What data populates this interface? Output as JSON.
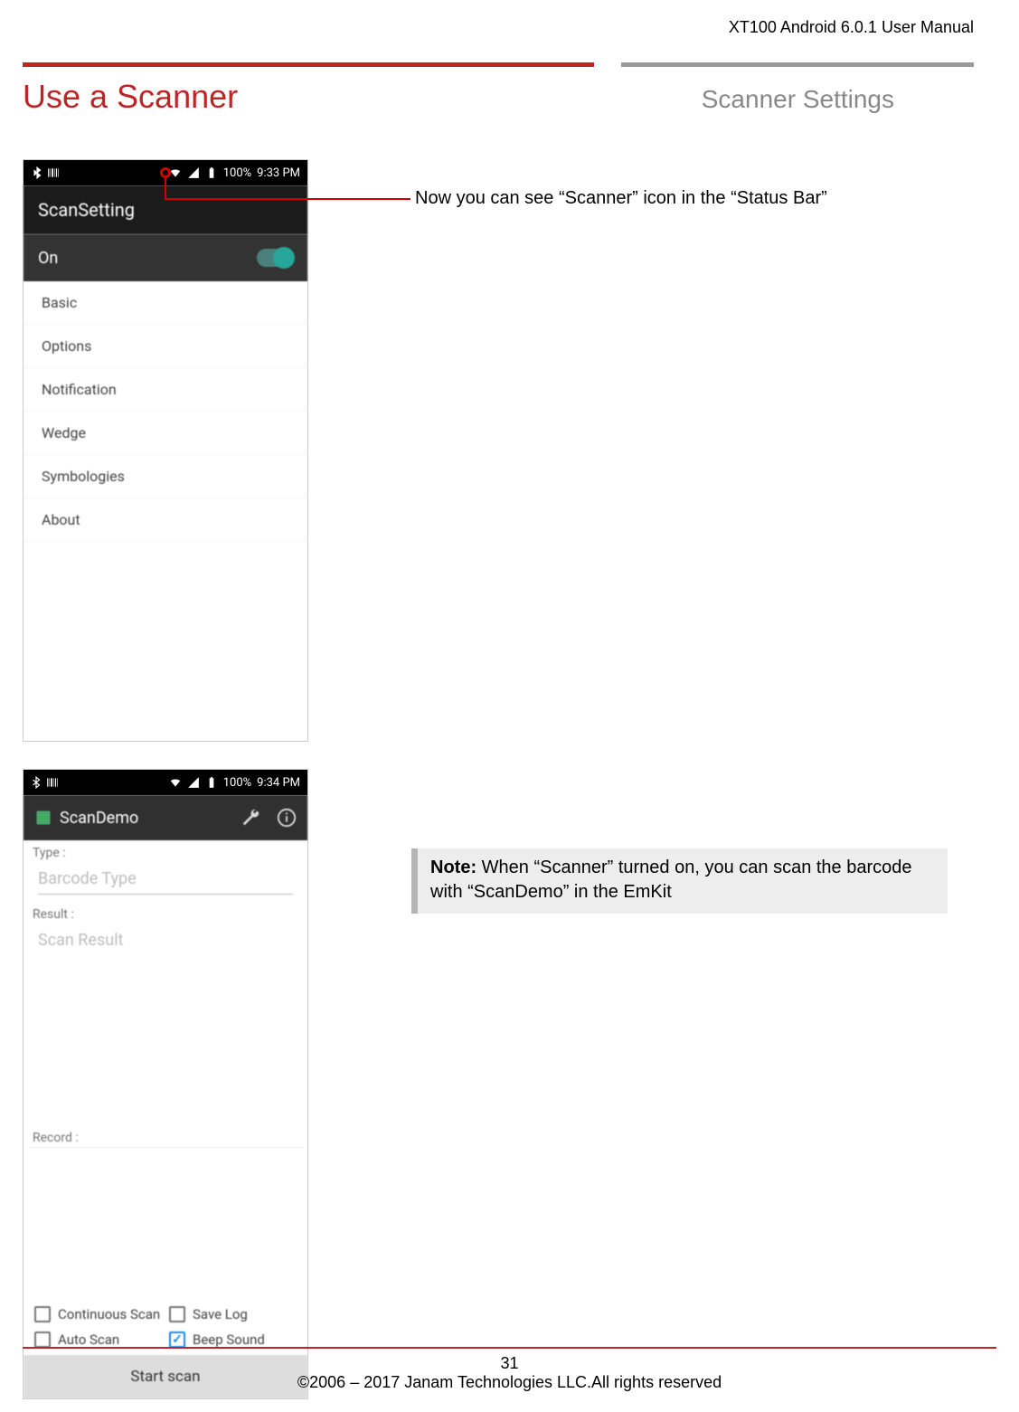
{
  "header": {
    "doc_title": "XT100 Android 6.0.1 User Manual"
  },
  "titles": {
    "left": "Use a Scanner",
    "right": "Scanner Settings"
  },
  "callout": {
    "text": "Now you can see “Scanner” icon in the “Status Bar”"
  },
  "phone1": {
    "status": {
      "battery": "100%",
      "time": "9:33 PM"
    },
    "app_title": "ScanSetting",
    "on_label": "On",
    "items": [
      "Basic",
      "Options",
      "Notification",
      "Wedge",
      "Symbologies",
      "About"
    ]
  },
  "phone2": {
    "status": {
      "battery": "100%",
      "time": "9:34 PM"
    },
    "app_title": "ScanDemo",
    "type_label": "Type :",
    "type_placeholder": "Barcode Type",
    "result_label": "Result :",
    "result_placeholder": "Scan Result",
    "record_label": "Record :",
    "checks": {
      "continuous": "Continuous Scan",
      "savelog": "Save Log",
      "autoscan": "Auto Scan",
      "beep": "Beep Sound"
    },
    "start_button": "Start scan"
  },
  "note": {
    "label": "Note:",
    "text": "  When “Scanner” turned on, you can scan the barcode with “ScanDemo” in the EmKit"
  },
  "footer": {
    "page": "31",
    "copyright": "©2006 – 2017 Janam Technologies LLC.All rights reserved"
  }
}
